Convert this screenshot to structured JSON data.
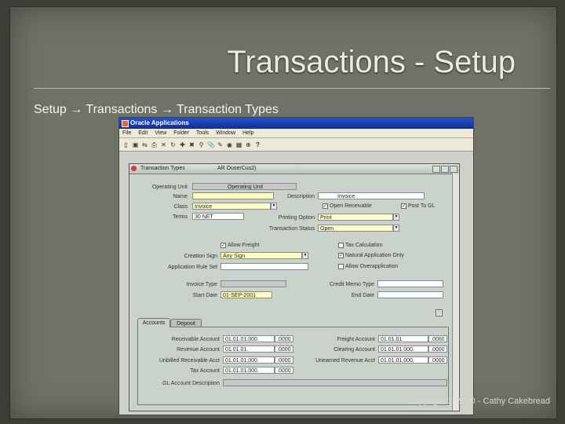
{
  "slide": {
    "title": "Transactions - Setup",
    "breadcrumb": "Setup → Transactions → Transaction Types",
    "copyright": "Copyright © 2010 - Cathy Cakebread"
  },
  "app": {
    "window_title": "Oracle Applications",
    "menu": [
      "File",
      "Edit",
      "View",
      "Folder",
      "Tools",
      "Window",
      "Help"
    ],
    "toolbar_icons": [
      "open-icon",
      "save-icon",
      "switch-icon",
      "print-icon",
      "close-icon",
      "refresh-icon",
      "new-icon",
      "delete-icon",
      "find-icon",
      "attachments-icon",
      "edit-icon",
      "translate-icon",
      "folder-icon",
      "zoom-icon",
      "help-icon"
    ],
    "form": {
      "title": "Transaction Types",
      "context": "AR OuserCus2)",
      "operating_unit_label": "Operating Unit",
      "operating_unit_header": "Operating Unit",
      "name_label": "Name",
      "name_value": "",
      "description_label": "Description",
      "description_value": "Invoice",
      "class_label": "Class",
      "class_value": "Invoice",
      "terms_label": "Terms",
      "terms_value": "30 NET",
      "printing_option_label": "Printing Option",
      "printing_option_value": "Print",
      "transaction_status_label": "Transaction Status",
      "transaction_status_value": "Open",
      "open_receivable_label": "Open Receivable",
      "post_to_gl_label": "Post To GL",
      "allow_freight_label": "Allow Freight",
      "tax_calculation_label": "Tax Calculation",
      "creation_sign_label": "Creation Sign",
      "creation_sign_value": "Any Sign",
      "natural_application_label": "Natural Application Only",
      "application_rule_label": "Application Rule Set",
      "allow_overapplication_label": "Allow Overapplication",
      "invoice_type_label": "Invoice Type",
      "credit_memo_type_label": "Credit Memo Type",
      "start_date_label": "Start Date",
      "start_date_value": "01-SEP-2001",
      "end_date_label": "End Date",
      "flex_label": "[ ]",
      "tabs": [
        "Accounts",
        "Deposit"
      ],
      "accounts_left": [
        {
          "label": "Receivable Account",
          "a": "01.01.01.000.",
          "b": ".0000"
        },
        {
          "label": "Revenue Account",
          "a": "01.01.01.",
          "b": ".0000"
        },
        {
          "label": "Unbilled Receivable Acct",
          "a": "01.01.01.000.",
          "b": ".0000"
        },
        {
          "label": "Tax Account",
          "a": "01.01.01.000.",
          "b": ".0000"
        }
      ],
      "accounts_right": [
        {
          "label": "Freight Account",
          "a": "01.01.01.",
          "b": ".0000"
        },
        {
          "label": "Clearing Account",
          "a": "01.01.01.000.",
          "b": ".0000"
        },
        {
          "label": "Unearned Revenue Acct",
          "a": "01.01.01.000.",
          "b": ".0000"
        }
      ],
      "gl_desc_label": "GL Account Description"
    }
  }
}
